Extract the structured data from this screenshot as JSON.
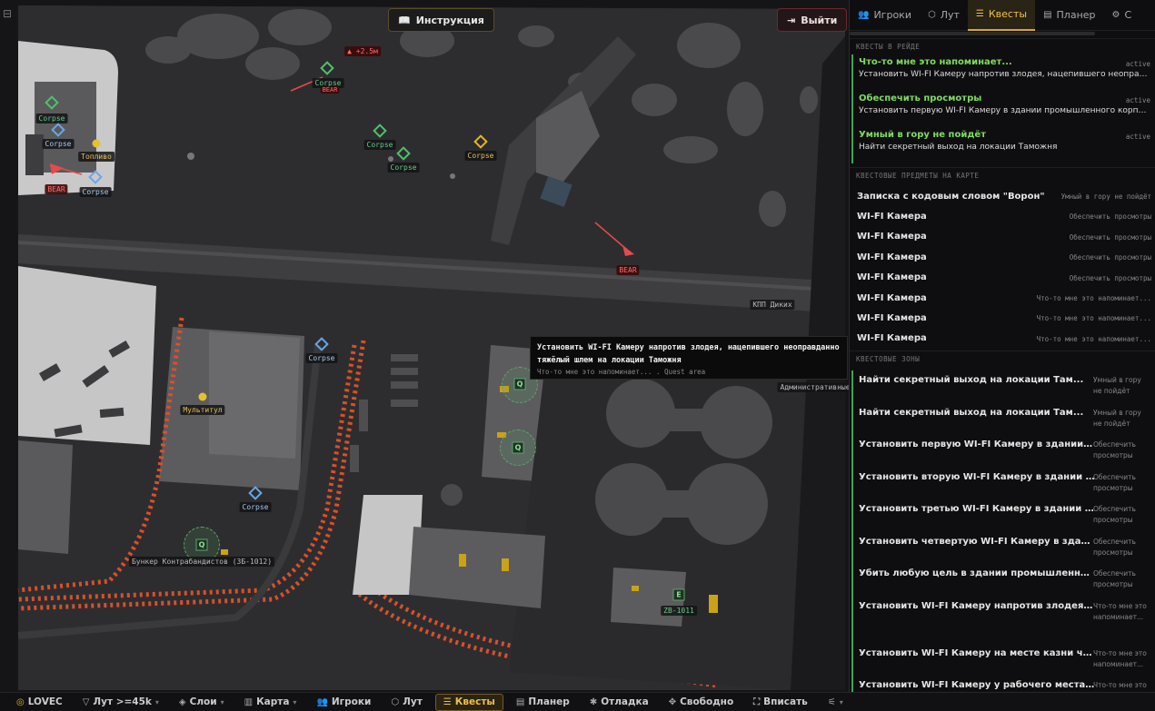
{
  "map": {
    "instr_label": "Инструкция",
    "exit_label": "Выйти",
    "markers": {
      "corpse": "Corpse",
      "bear": "BEAR",
      "fuel": "Топливо",
      "multitool": "Мультитул",
      "elevation": "▲ +2.5м",
      "kpp": "КПП Диких",
      "admin": "Административные",
      "bunker": "Бункер Контрабандистов (ЗБ-1012)",
      "zb1011": "ZB-1011",
      "q": "Q",
      "e": "E"
    },
    "tooltip": {
      "title": "Установить WI-FI Камеру напротив злодея, нацепившего неоправданно тяжёлый шлем на локации Таможня",
      "sub": "Что-то мне это напоминает... . Quest area"
    }
  },
  "panel": {
    "tabs": [
      {
        "label": "Игроки",
        "icon": "players-icon"
      },
      {
        "label": "Лут",
        "icon": "loot-icon"
      },
      {
        "label": "Квесты",
        "icon": "quests-icon",
        "active": true
      },
      {
        "label": "Планер",
        "icon": "planner-icon"
      },
      {
        "label": "С",
        "icon": "settings-icon"
      }
    ],
    "section_raid": "КВЕСТЫ В РЕЙДЕ",
    "raid_quests": [
      {
        "title": "Что-то мне это напоминает...",
        "desc": "Установить WI-FI Камеру напротив злодея, нацепившего неоправд...",
        "status": "active"
      },
      {
        "title": "Обеспечить просмотры",
        "desc": "Установить первую WI-FI Камеру в здании промышленного корпус...",
        "status": "active"
      },
      {
        "title": "Умный в гору не пойдёт",
        "desc": "Найти секретный выход на локации Таможня",
        "status": "active"
      }
    ],
    "section_items": "КВЕСТОВЫЕ ПРЕДМЕТЫ НА КАРТЕ",
    "items": [
      {
        "name": "Записка с кодовым словом \"Ворон\"",
        "quest": "Умный в гору не пойдёт"
      },
      {
        "name": "WI-FI Камера",
        "quest": "Обеспечить просмотры"
      },
      {
        "name": "WI-FI Камера",
        "quest": "Обеспечить просмотры"
      },
      {
        "name": "WI-FI Камера",
        "quest": "Обеспечить просмотры"
      },
      {
        "name": "WI-FI Камера",
        "quest": "Обеспечить просмотры"
      },
      {
        "name": "WI-FI Камера",
        "quest": "Что-то мне это напоминает..."
      },
      {
        "name": "WI-FI Камера",
        "quest": "Что-то мне это напоминает..."
      },
      {
        "name": "WI-FI Камера",
        "quest": "Что-то мне это напоминает..."
      }
    ],
    "section_zones": "КВЕСТОВЫЕ ЗОНЫ",
    "zones": [
      {
        "name": "Найти секретный выход на локации Там...",
        "quest": "Умный в гору не пойдёт"
      },
      {
        "name": "Найти секретный выход на локации Там...",
        "quest": "Умный в гору не пойдёт"
      },
      {
        "name": "Установить первую WI-FI Камеру в здании пром...",
        "quest": "Обеспечить просмотры"
      },
      {
        "name": "Установить вторую WI-FI Камеру в здании промы...",
        "quest": "Обеспечить просмотры"
      },
      {
        "name": "Установить третью WI-FI Камеру в здании промы...",
        "quest": "Обеспечить просмотры"
      },
      {
        "name": "Установить четвертую WI-FI Камеру в здании про...",
        "quest": "Обеспечить просмотры"
      },
      {
        "name": "Убить любую цель в здании промышленного ко...",
        "quest": "Обеспечить просмотры"
      },
      {
        "name": "Установить WI-FI Камеру напротив злодея, нац...",
        "quest": "Что-то мне это напоминает..."
      },
      {
        "name": "Установить WI-FI Камеру на месте казни член...",
        "quest": "Что-то мне это напоминает..."
      },
      {
        "name": "Установить WI-FI Камеру у рабочего места ин...",
        "quest": "Что-то мне это напоминает..."
      }
    ]
  },
  "bottombar": {
    "map_name": "LOVEC",
    "loot_filter": "Лут >=45k",
    "layers": "Слои",
    "map": "Карта",
    "players": "Игроки",
    "loot": "Лут",
    "quests": "Квесты",
    "planner": "Планер",
    "debug": "Отладка",
    "free": "Свободно",
    "fit": "Вписать"
  }
}
